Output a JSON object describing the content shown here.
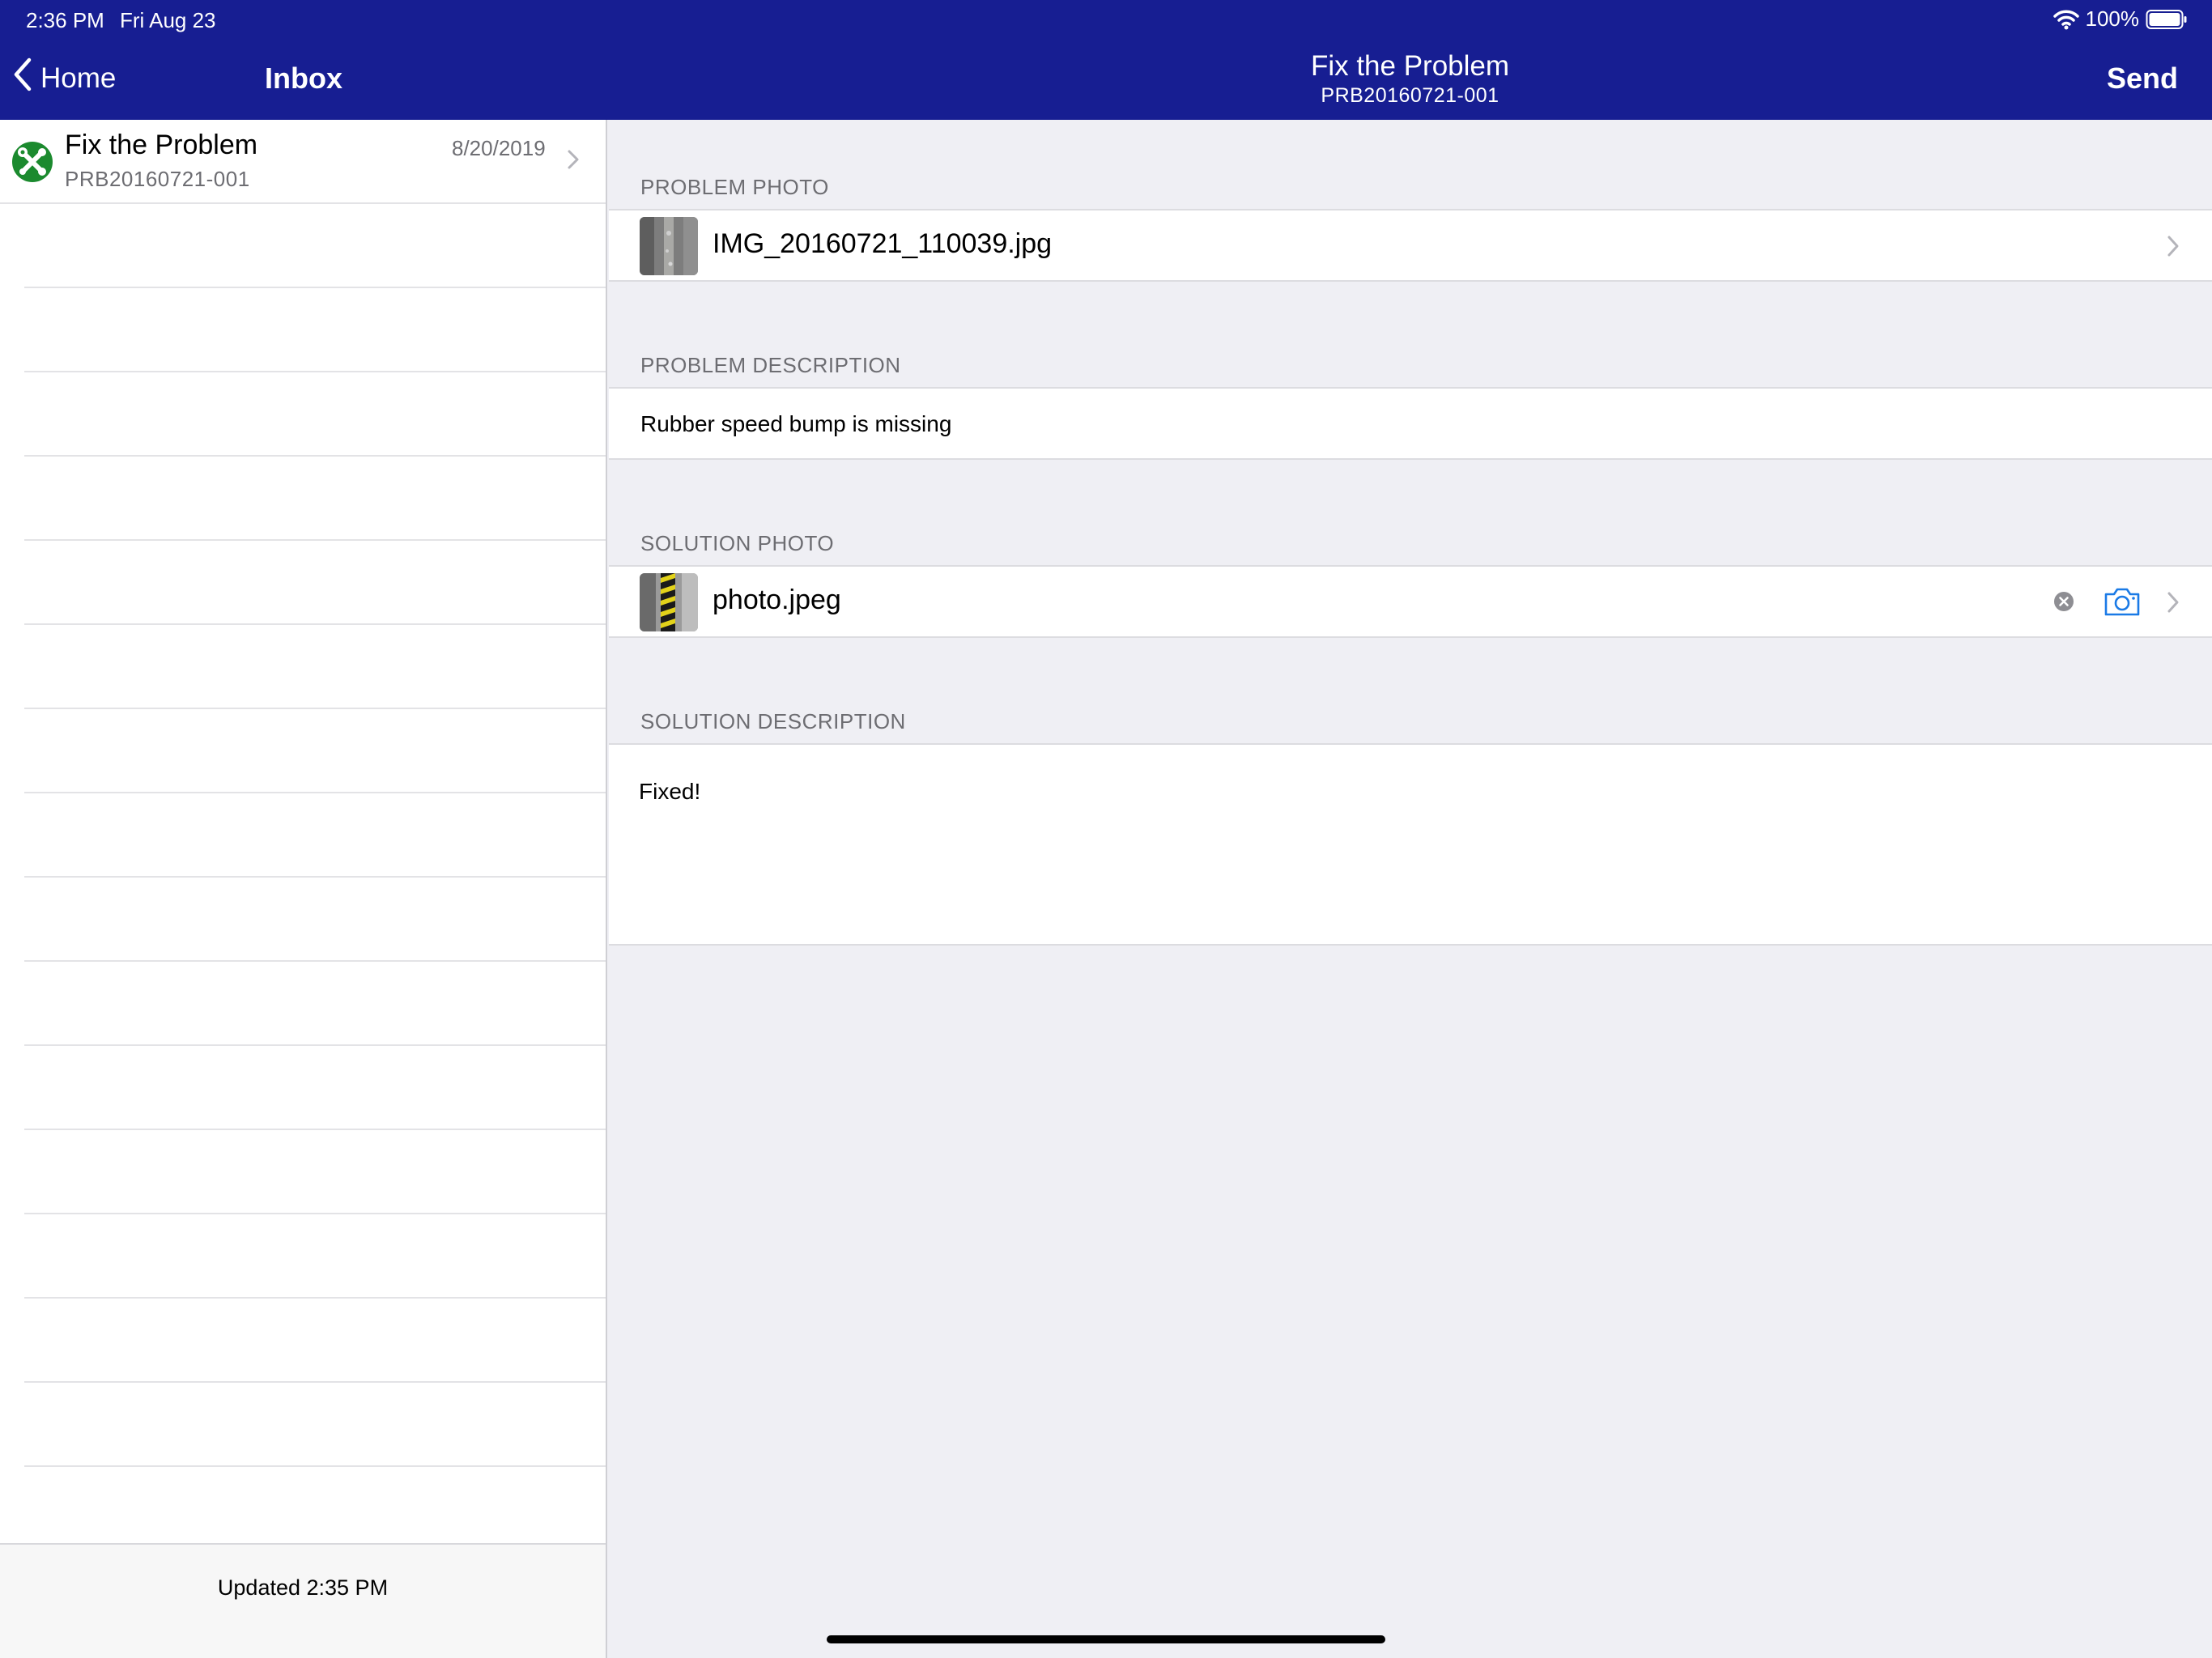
{
  "status_bar": {
    "time": "2:36 PM",
    "date": "Fri Aug 23",
    "battery": "100%"
  },
  "master": {
    "back_label": "Home",
    "title": "Inbox",
    "items": [
      {
        "title": "Fix the Problem",
        "subtitle": "PRB20160721-001",
        "date": "8/20/2019"
      }
    ],
    "footer": "Updated 2:35 PM"
  },
  "detail": {
    "title": "Fix the Problem",
    "subtitle": "PRB20160721-001",
    "send_label": "Send",
    "sections": {
      "problem_photo": {
        "header": "PROBLEM PHOTO",
        "file": "IMG_20160721_110039.jpg"
      },
      "problem_description": {
        "header": "PROBLEM DESCRIPTION",
        "text": "Rubber speed bump is missing"
      },
      "solution_photo": {
        "header": "SOLUTION PHOTO",
        "file": "photo.jpeg"
      },
      "solution_description": {
        "header": "SOLUTION DESCRIPTION",
        "text": "Fixed!"
      }
    }
  },
  "colors": {
    "nav_bar": "#171e92",
    "accent_blue": "#1a7ae6",
    "status_green": "#1b8a2e"
  },
  "icons": [
    "wifi-icon",
    "battery-icon",
    "back-chevron-icon",
    "tools-icon",
    "chevron-right-icon",
    "clear-icon",
    "camera-icon"
  ]
}
